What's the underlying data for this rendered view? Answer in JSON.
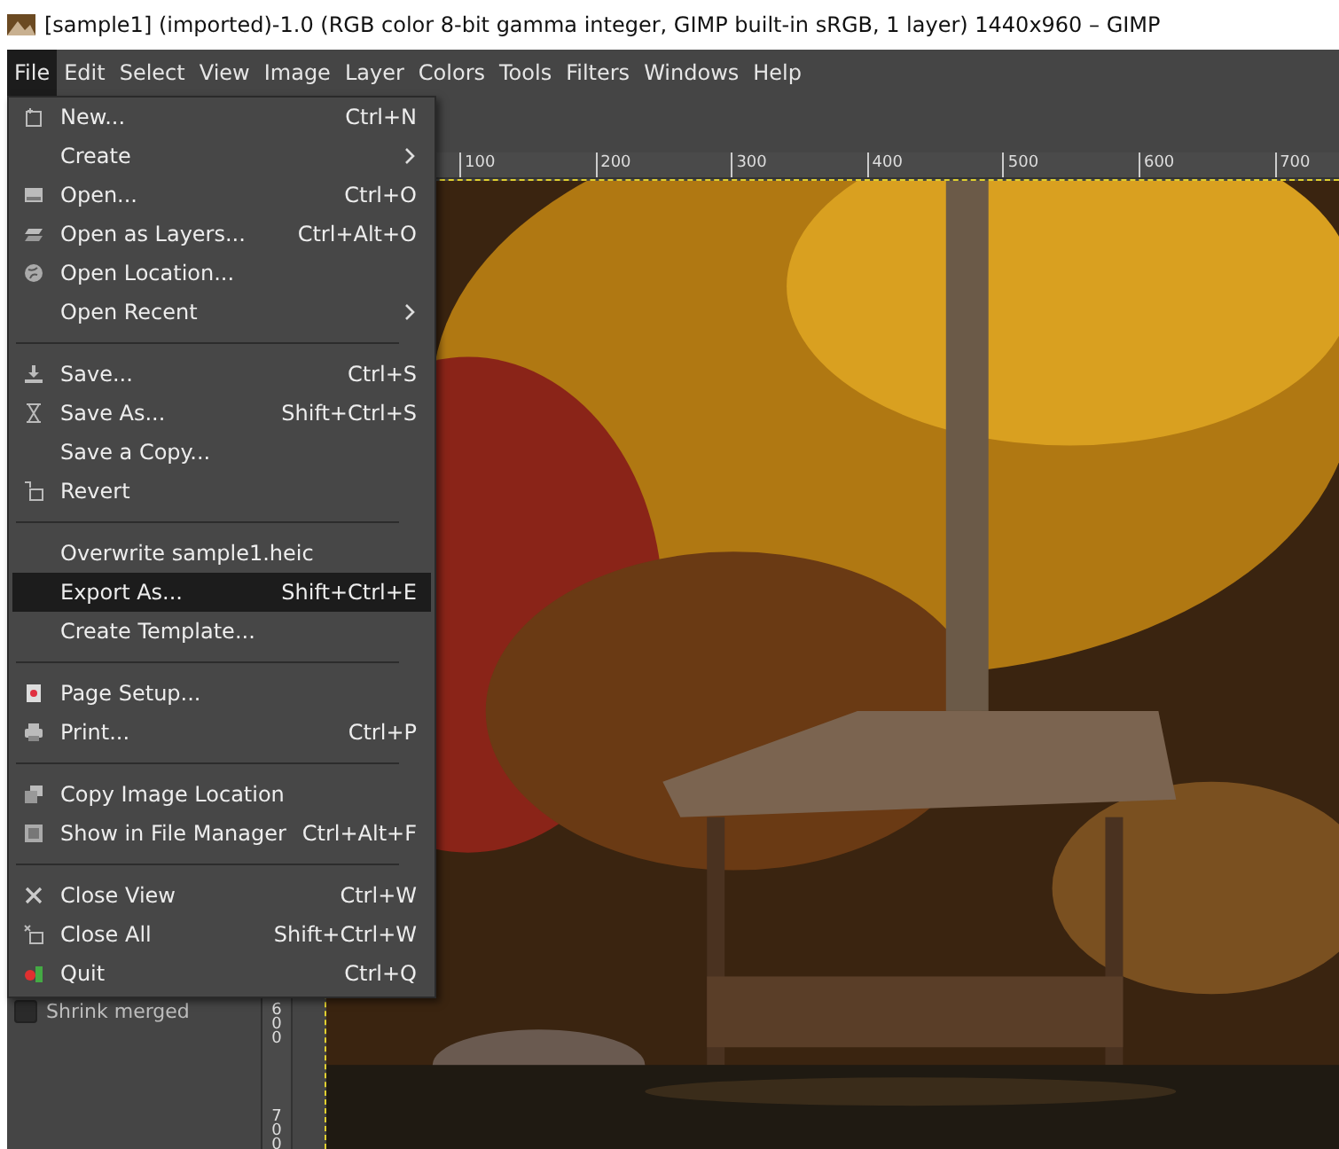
{
  "window": {
    "title": "[sample1] (imported)-1.0 (RGB color 8-bit gamma integer, GIMP built-in sRGB, 1 layer) 1440x960 – GIMP"
  },
  "menubar": [
    {
      "label": "File",
      "selected": true
    },
    {
      "label": "Edit",
      "selected": false
    },
    {
      "label": "Select",
      "selected": false
    },
    {
      "label": "View",
      "selected": false
    },
    {
      "label": "Image",
      "selected": false
    },
    {
      "label": "Layer",
      "selected": false
    },
    {
      "label": "Colors",
      "selected": false
    },
    {
      "label": "Tools",
      "selected": false
    },
    {
      "label": "Filters",
      "selected": false
    },
    {
      "label": "Windows",
      "selected": false
    },
    {
      "label": "Help",
      "selected": false
    }
  ],
  "file_menu": [
    {
      "kind": "item",
      "label": "New...",
      "shortcut": "Ctrl+N",
      "submenu": false,
      "selected": false
    },
    {
      "kind": "item",
      "label": "Create",
      "submenu": true,
      "selected": false
    },
    {
      "kind": "item",
      "label": "Open...",
      "shortcut": "Ctrl+O",
      "submenu": false,
      "selected": false
    },
    {
      "kind": "item",
      "label": "Open as Layers...",
      "shortcut": "Ctrl+Alt+O",
      "submenu": false,
      "selected": false
    },
    {
      "kind": "item",
      "label": "Open Location...",
      "submenu": false,
      "selected": false
    },
    {
      "kind": "item",
      "label": "Open Recent",
      "submenu": true,
      "selected": false
    },
    {
      "kind": "separator"
    },
    {
      "kind": "item",
      "label": "Save...",
      "shortcut": "Ctrl+S",
      "submenu": false,
      "selected": false
    },
    {
      "kind": "item",
      "label": "Save As...",
      "shortcut": "Shift+Ctrl+S",
      "submenu": false,
      "selected": false
    },
    {
      "kind": "item",
      "label": "Save a Copy...",
      "submenu": false,
      "selected": false
    },
    {
      "kind": "item",
      "label": "Revert",
      "submenu": false,
      "selected": false
    },
    {
      "kind": "separator"
    },
    {
      "kind": "item",
      "label": "Overwrite sample1.heic",
      "submenu": false,
      "selected": false
    },
    {
      "kind": "item",
      "label": "Export As...",
      "shortcut": "Shift+Ctrl+E",
      "submenu": false,
      "selected": true
    },
    {
      "kind": "item",
      "label": "Create Template...",
      "submenu": false,
      "selected": false
    },
    {
      "kind": "separator"
    },
    {
      "kind": "item",
      "label": "Page Setup...",
      "submenu": false,
      "selected": false
    },
    {
      "kind": "item",
      "label": "Print...",
      "shortcut": "Ctrl+P",
      "submenu": false,
      "selected": false
    },
    {
      "kind": "separator"
    },
    {
      "kind": "item",
      "label": "Copy Image Location",
      "submenu": false,
      "selected": false
    },
    {
      "kind": "item",
      "label": "Show in File Manager",
      "shortcut": "Ctrl+Alt+F",
      "submenu": false,
      "selected": false
    },
    {
      "kind": "separator"
    },
    {
      "kind": "item",
      "label": "Close View",
      "shortcut": "Ctrl+W",
      "submenu": false,
      "selected": false
    },
    {
      "kind": "item",
      "label": "Close All",
      "shortcut": "Shift+Ctrl+W",
      "submenu": false,
      "selected": false
    },
    {
      "kind": "item",
      "label": "Quit",
      "shortcut": "Ctrl+Q",
      "submenu": false,
      "selected": false
    }
  ],
  "left_panel": {
    "option": {
      "label": "Shrink merged",
      "checked": false
    }
  },
  "horizontal_ruler": [
    "100",
    "200",
    "300",
    "400",
    "500",
    "600",
    "700"
  ],
  "vertical_ruler": [
    "600",
    "700"
  ]
}
